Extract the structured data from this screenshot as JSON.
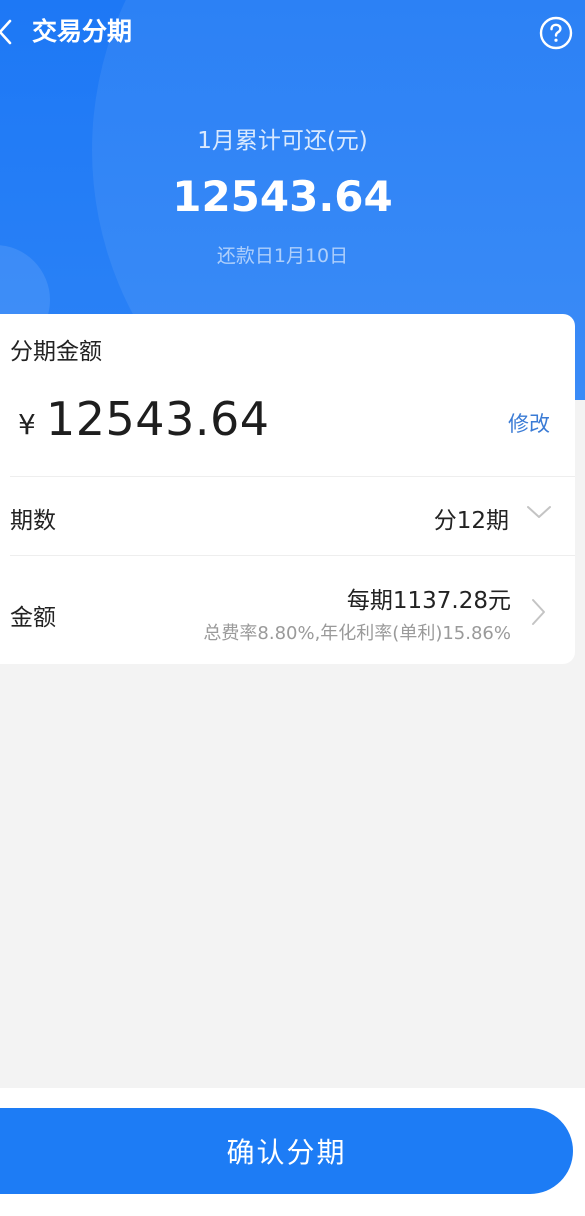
{
  "header": {
    "title": "交易分期",
    "back_icon": "chevron-left-icon",
    "help_icon": "question-circle-icon",
    "accent_color": "#1d78f5"
  },
  "summary": {
    "label": "1月累计可还(元)",
    "amount": "12543.64",
    "due_date": "还款日1月10日"
  },
  "installment": {
    "title": "分期金额",
    "currency_symbol": "¥",
    "amount": "12543.64",
    "edit_label": "修改",
    "period_label": "期数",
    "period_value": "分12期",
    "money_label": "金额",
    "per_period": "每期1137.28元",
    "rate_info": "总费率8.80%,年化利率(单利)15.86%"
  },
  "footer": {
    "confirm_label": "确认分期"
  }
}
